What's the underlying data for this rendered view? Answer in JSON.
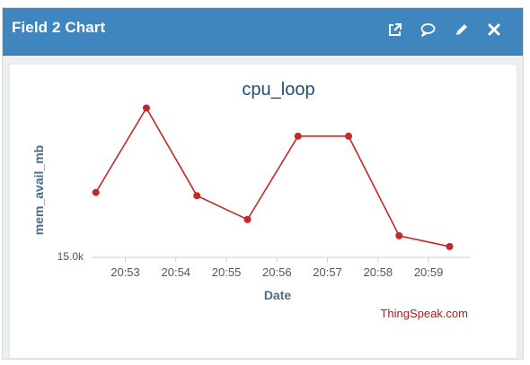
{
  "header": {
    "title": "Field 2 Chart",
    "icons": [
      "external-link-icon",
      "comment-icon",
      "pencil-icon",
      "close-icon"
    ]
  },
  "credit": "ThingSpeak.com",
  "colors": {
    "header_bg": "#3f85be",
    "series": "#c62828",
    "title": "#1f4e79",
    "credit": "#b3191b"
  },
  "chart_data": {
    "type": "line",
    "title": "cpu_loop",
    "xlabel": "Date",
    "ylabel": "mem_avail_mb",
    "x_ticks": [
      "20:53",
      "20:54",
      "20:55",
      "20:56",
      "20:57",
      "20:58",
      "20:59"
    ],
    "y_ticks": [
      "15.0k"
    ],
    "x_range": [
      "20:52:20",
      "20:59:50"
    ],
    "series": [
      {
        "points": [
          {
            "x": "20:52:25",
            "y": 15055
          },
          {
            "x": "20:53:25",
            "y": 15133
          },
          {
            "x": "20:54:25",
            "y": 15052
          },
          {
            "x": "20:55:25",
            "y": 15030
          },
          {
            "x": "20:56:25",
            "y": 15107
          },
          {
            "x": "20:57:25",
            "y": 15107
          },
          {
            "x": "20:58:25",
            "y": 15015
          },
          {
            "x": "20:59:25",
            "y": 15005
          }
        ]
      }
    ],
    "ylim": [
      14995,
      15140
    ],
    "grid": false,
    "legend": "none"
  }
}
